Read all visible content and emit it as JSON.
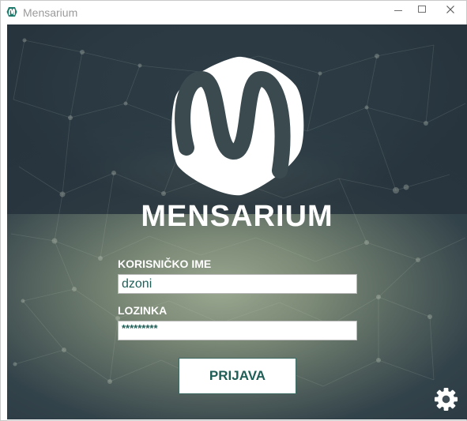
{
  "window": {
    "title": "Mensarium",
    "app_icon": "mensarium-logo-icon",
    "controls": [
      "minimize-icon",
      "maximize-icon",
      "close-icon"
    ]
  },
  "brand": {
    "logo": "mensarium-logo",
    "name": "MENSARIUM"
  },
  "form": {
    "username": {
      "label": "KORISNIČKO IME",
      "value": "dzoni"
    },
    "password": {
      "label": "LOZINKA",
      "masked_value": "*********"
    },
    "login_button": "PRIJAVA"
  },
  "settings": {
    "icon": "gear-icon"
  },
  "colors": {
    "accent": "#1f5e57",
    "background_dark": "#2d3c45",
    "background_light": "#9aa790"
  }
}
